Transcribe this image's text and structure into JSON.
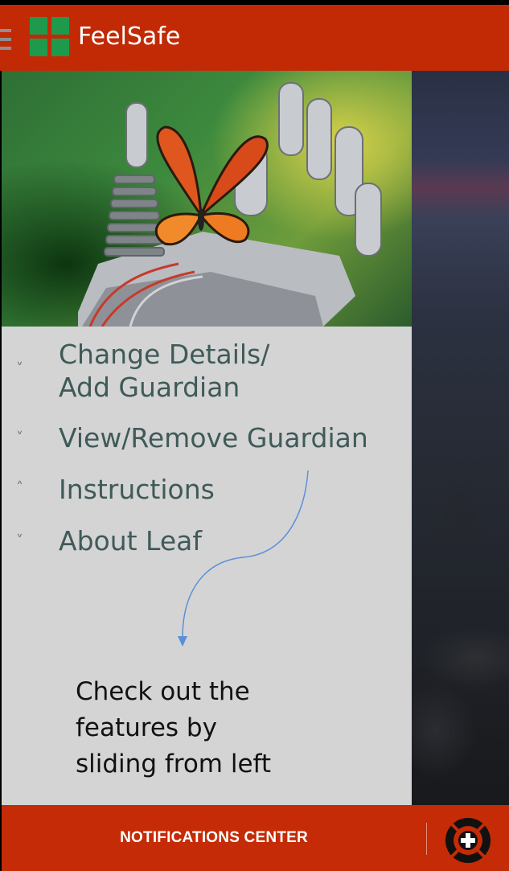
{
  "app": {
    "title": "FeelSafe",
    "icons": {
      "menu": "hamburger-icon",
      "logo": "four-squares-logo"
    }
  },
  "drawer": {
    "menu_items": [
      {
        "label_line1": "Change Details/",
        "label_line2": "Add Guardian",
        "chevron": "˅"
      },
      {
        "label": "View/Remove Guardian",
        "chevron": "˅"
      },
      {
        "label": "Instructions",
        "chevron": "˄"
      },
      {
        "label": "About Leaf",
        "chevron": "˅"
      }
    ],
    "hint_lines": [
      "Check out the",
      "features by",
      "sliding from left"
    ]
  },
  "bottom_bar": {
    "notifications_label": "NOTIFICATIONS CENTER",
    "sos_icon": "lifebuoy-plus-icon"
  },
  "colors": {
    "app_bar": "#c22a06",
    "logo_green": "#1f9a4d",
    "drawer_bg": "#d4d4d4",
    "menu_text": "#3f5a59",
    "arrow": "#5b8fd6"
  }
}
